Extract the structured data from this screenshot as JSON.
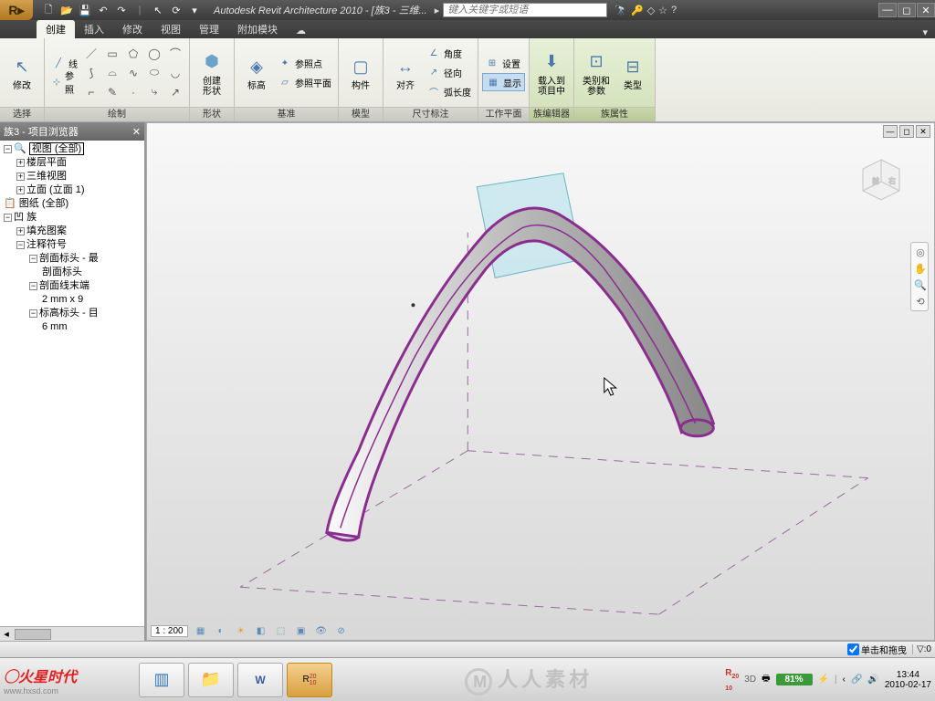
{
  "titlebar": {
    "app_title": "Autodesk Revit Architecture 2010 - [族3 - 三维...",
    "search_placeholder": "键入关键字或短语"
  },
  "tabs": {
    "create": "创建",
    "insert": "插入",
    "modify": "修改",
    "view": "视图",
    "manage": "管理",
    "addins": "附加模块"
  },
  "ribbon": {
    "select": {
      "title": "选择",
      "modify": "修改"
    },
    "draw": {
      "title": "绘制",
      "line": "线",
      "ref": "参照"
    },
    "shape": {
      "title": "形状",
      "create_shape": "创建\n形状"
    },
    "datum": {
      "title": "基准",
      "level": "标高",
      "ref_point": "参照点",
      "ref_plane": "参照平面"
    },
    "model": {
      "title": "模型",
      "component": "构件"
    },
    "dim": {
      "title": "尺寸标注",
      "align": "对齐",
      "angle": "角度",
      "radius": "径向",
      "arc": "弧长度"
    },
    "workplane": {
      "title": "工作平面",
      "settings": "设置",
      "show": "显示"
    },
    "family_editor": {
      "title": "族编辑器",
      "load": "载入到\n项目中"
    },
    "family_props": {
      "title": "族属性",
      "cat_param": "类别和\n参数",
      "types": "类型"
    }
  },
  "browser": {
    "title": "族3 - 项目浏览器",
    "views": "视图 (全部)",
    "floor_plans": "楼层平面",
    "three_d": "三维视图",
    "elevations": "立面 (立面 1)",
    "sheets": "图纸 (全部)",
    "families": "族",
    "fill_patterns": "填充图案",
    "annotation": "注释符号",
    "section_head": "剖面标头 - 最",
    "section_head2": "剖面标头",
    "section_line": "剖面线末端",
    "spec1": "2 mm x 9",
    "level_head": "标高标头 - 目",
    "spec2": "6 mm"
  },
  "view_controls": {
    "scale": "1 : 200"
  },
  "statusbar": {
    "drag": "单击和拖曳",
    "filter": ":0"
  },
  "taskbar": {
    "logo1": "火星时代",
    "logo2": "www.hxsd.com",
    "watermark": "人人素材",
    "battery": "81%",
    "time": "13:44",
    "date": "2010-02-17"
  }
}
